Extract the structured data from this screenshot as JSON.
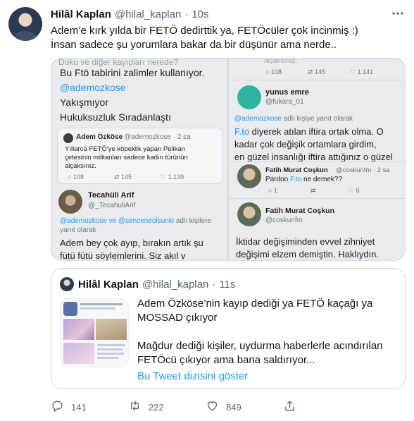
{
  "tweet": {
    "author_name": "Hilâl Kaplan",
    "author_handle": "@hilal_kaplan",
    "separator": "·",
    "time": "10s",
    "text_line1": "Adem’e kırk yılda bir FETÖ dedirttik ya, FETÖcüler çok incinmiş :)",
    "text_line2": "İnsan sadece şu yorumlara bakar da bir düşünür ama nerde..",
    "more_icon": "more-icon"
  },
  "media": {
    "left": {
      "line_cut": "Doku ve diğer kayıpları nerede?",
      "line1": "Bu Ftö tabirini zalimler kullanıyor.",
      "mention1": "@ademozkose",
      "line2": "Yakışmıyor",
      "line3": "Hukuksuzluk Sıradanlaştı",
      "qt_name": "Adem Özköse",
      "qt_handle": "@ademozkose · 2 sa",
      "qt_line1": "Yıllarca FETÖ’ye köpeklik yapan Pelikan",
      "qt_line2": "çetesinin militanları sadece kadın türünün",
      "qt_line3": "alçaksınız.",
      "qt_reply": "108",
      "qt_rt": "145",
      "qt_like": "1.139",
      "u2_name": "Tecahüli Arif",
      "u2_handle": "@_TecahuliArif",
      "u2_reply_prefix": "@ademozkose ve @senceneolsunki",
      "u2_reply_suffix": "adlı kişilere",
      "u2_reply_line2": "yanıt olarak",
      "u2_line1": "Adem bey çok ayıp, bırakın artık şu",
      "u2_line2": "fütü fütü söylemlerini. Siz akıl v"
    },
    "right": {
      "top_cut": "alçaksınız.",
      "top_reply": "108",
      "top_rt": "145",
      "top_like": "1.141",
      "u1_name": "yunus emre",
      "u1_handle": "@fukara_01",
      "u1_reply_mention": "@ademozkose",
      "u1_reply_suffix": "adlı kişiye yanıt olarak",
      "u1_line1_link": "F.to",
      "u1_line1": "diyerek atılan iftira ortak olma. O",
      "u1_line2": "kadar çok değişik  ortamlara girdim,",
      "u1_line3": "en güzel insanlığı iftira attığınız o güzel",
      "u2_name": "Fatih Murat Coşkun",
      "u2_handle": "@coskunfm · 2 sa",
      "u2_text_a": "Pardon",
      "u2_text_link": "F.to",
      "u2_text_b": "ne demek??",
      "u2_reply": "1",
      "u2_rt": "",
      "u2_like": "6",
      "u3_name": "Fatih Murat Coşkun",
      "u3_handle": "@coskunfm",
      "u3_line1": "İktidar değişiminden evvel zihniyet",
      "u3_line2": "değişimi elzem demiştin. Haklıydın."
    }
  },
  "quote": {
    "author_name": "Hilâl Kaplan",
    "author_handle": "@hilal_kaplan",
    "separator": "·",
    "time": "11s",
    "text_line1": "Adem Özköse’nin kayıp dediği ya FETÖ kaçağı ya",
    "text_line2": "MOSSAD çıkıyor",
    "text_line3": "Mağdur dediği kişiler, uydurma haberlerle acındırılan",
    "text_line4": "FETÖcü çıkıyor ama bana saldırıyor...",
    "thread_link": "Bu Tweet dizisini göster"
  },
  "actions": {
    "reply_count": "141",
    "retweet_count": "222",
    "like_count": "849"
  },
  "colors": {
    "text": "#0f1419",
    "secondary": "#536471",
    "link": "#1d9bf0",
    "border": "#cfd9de"
  }
}
